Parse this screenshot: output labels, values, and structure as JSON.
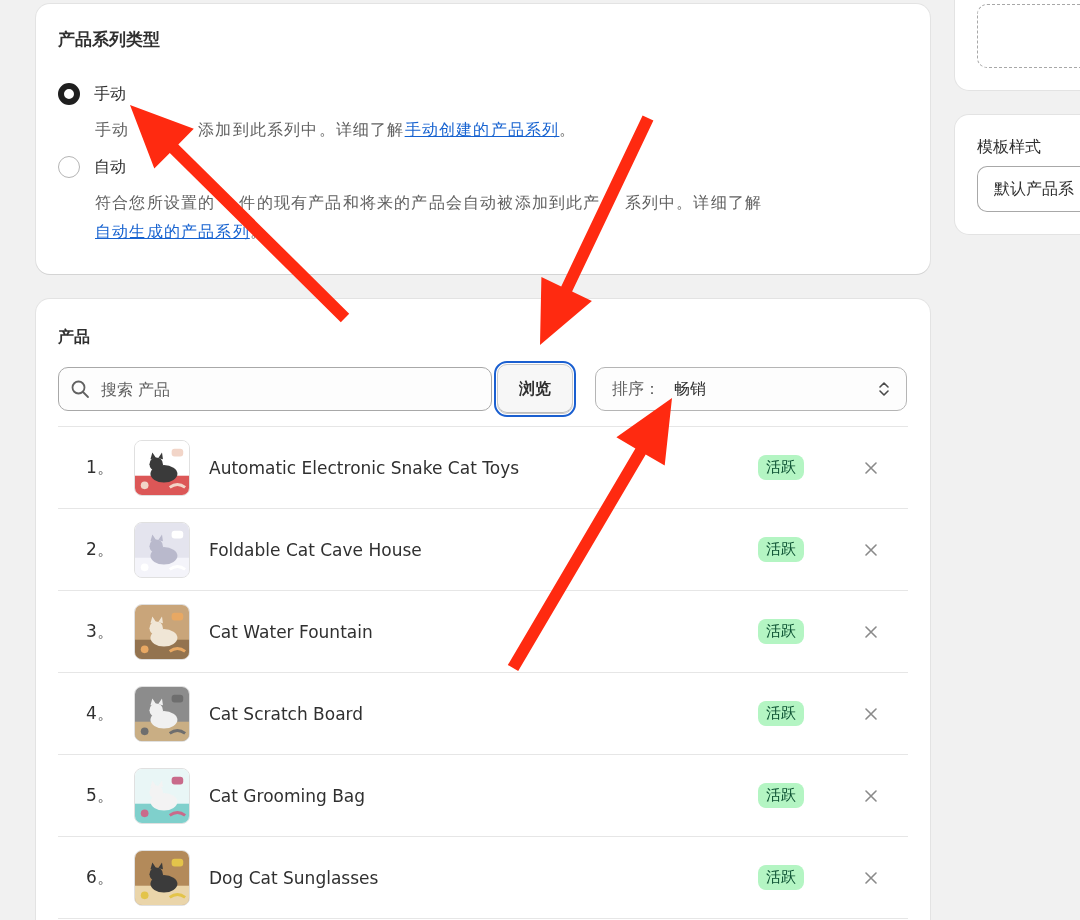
{
  "collection_type": {
    "title": "产品系列类型",
    "options": [
      {
        "label": "手动",
        "selected": true,
        "description": [
          "手动",
          "添加到此系列中。详细了解"
        ],
        "link": "手动创建的产品系列",
        "suffix": "。"
      },
      {
        "label": "自动",
        "selected": false,
        "description": [
          "符合您所设置的",
          "件的现有产品和将来的产品会自动被添加到此产",
          "系列中。详细了解"
        ],
        "link": "自动生成的产品系列",
        "suffix": "。"
      }
    ]
  },
  "products": {
    "title": "产品",
    "search": {
      "placeholder": "搜索 产品"
    },
    "browse_button": {
      "label": "浏览",
      "focused": true
    },
    "sort": {
      "label": "排序：",
      "value": "畅销"
    },
    "items": [
      {
        "index": "1。",
        "name": "Automatic Electronic Snake Cat Toys",
        "status": "活跃",
        "kind": "picture"
      },
      {
        "index": "2。",
        "name": "Foldable Cat Cave House",
        "status": "活跃",
        "kind": "picture"
      },
      {
        "index": "3。",
        "name": "Cat Water Fountain",
        "status": "活跃",
        "kind": "picture"
      },
      {
        "index": "4。",
        "name": "Cat Scratch Board",
        "status": "活跃",
        "kind": "picture"
      },
      {
        "index": "5。",
        "name": "Cat Grooming Bag",
        "status": "活跃",
        "kind": "picture"
      },
      {
        "index": "6。",
        "name": "Dog Cat Sunglasses",
        "status": "活跃",
        "kind": "picture"
      }
    ]
  },
  "template": {
    "title": "模板样式",
    "value": "默认产品系"
  },
  "annotation_arrows": [
    {
      "kind": "arrow"
    },
    {
      "kind": "arrow"
    },
    {
      "kind": "arrow"
    }
  ]
}
